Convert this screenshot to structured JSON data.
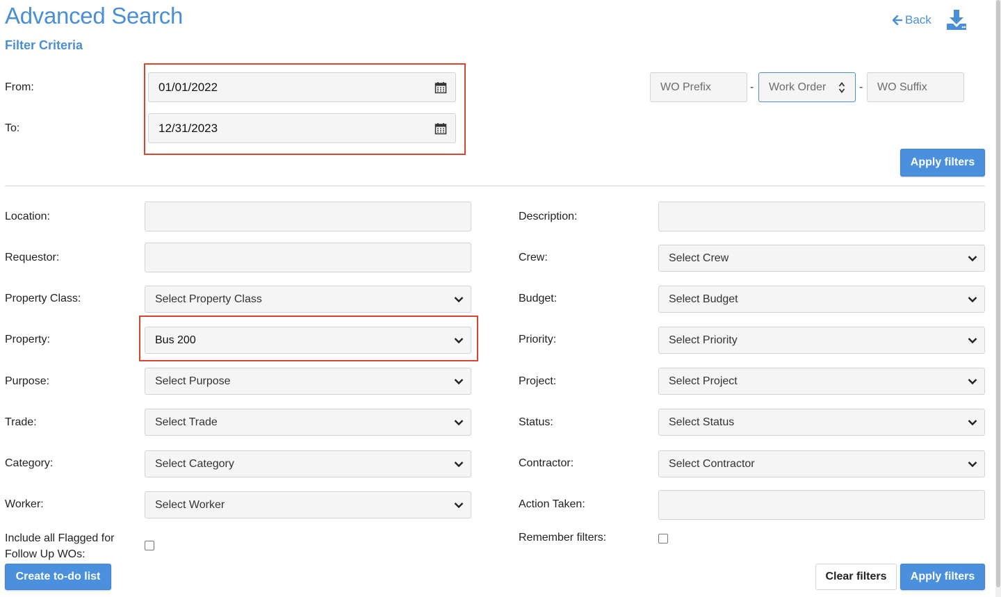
{
  "header": {
    "title": "Advanced Search",
    "subtitle": "Filter Criteria",
    "back_label": "Back",
    "back_icon": "arrow-left-icon",
    "download_icon": "download-icon"
  },
  "dates": {
    "from_label": "From:",
    "from_value": "01/01/2022",
    "to_label": "To:",
    "to_value": "12/31/2023"
  },
  "work_order": {
    "prefix_placeholder": "WO Prefix",
    "order_placeholder": "Work Order",
    "suffix_placeholder": "WO Suffix",
    "separator": "-"
  },
  "buttons": {
    "apply_filters": "Apply filters",
    "clear_filters": "Clear filters",
    "create_todo": "Create to-do list"
  },
  "left_fields": {
    "location_label": "Location:",
    "requestor_label": "Requestor:",
    "property_class_label": "Property Class:",
    "property_class_value": "Select Property Class",
    "property_label": "Property:",
    "property_value": "Bus 200",
    "purpose_label": "Purpose:",
    "purpose_value": "Select Purpose",
    "trade_label": "Trade:",
    "trade_value": "Select Trade",
    "category_label": "Category:",
    "category_value": "Select Category",
    "worker_label": "Worker:",
    "worker_value": "Select Worker",
    "flagged_label_line1": "Include all Flagged for",
    "flagged_label_line2": "Follow Up WOs:"
  },
  "right_fields": {
    "description_label": "Description:",
    "crew_label": "Crew:",
    "crew_value": "Select Crew",
    "budget_label": "Budget:",
    "budget_value": "Select Budget",
    "priority_label": "Priority:",
    "priority_value": "Select Priority",
    "project_label": "Project:",
    "project_value": "Select Project",
    "status_label": "Status:",
    "status_value": "Select Status",
    "contractor_label": "Contractor:",
    "contractor_value": "Select Contractor",
    "action_taken_label": "Action Taken:",
    "remember_label": "Remember filters:"
  },
  "colors": {
    "accent": "#4a8fd6",
    "highlight_box": "#d9442e"
  }
}
